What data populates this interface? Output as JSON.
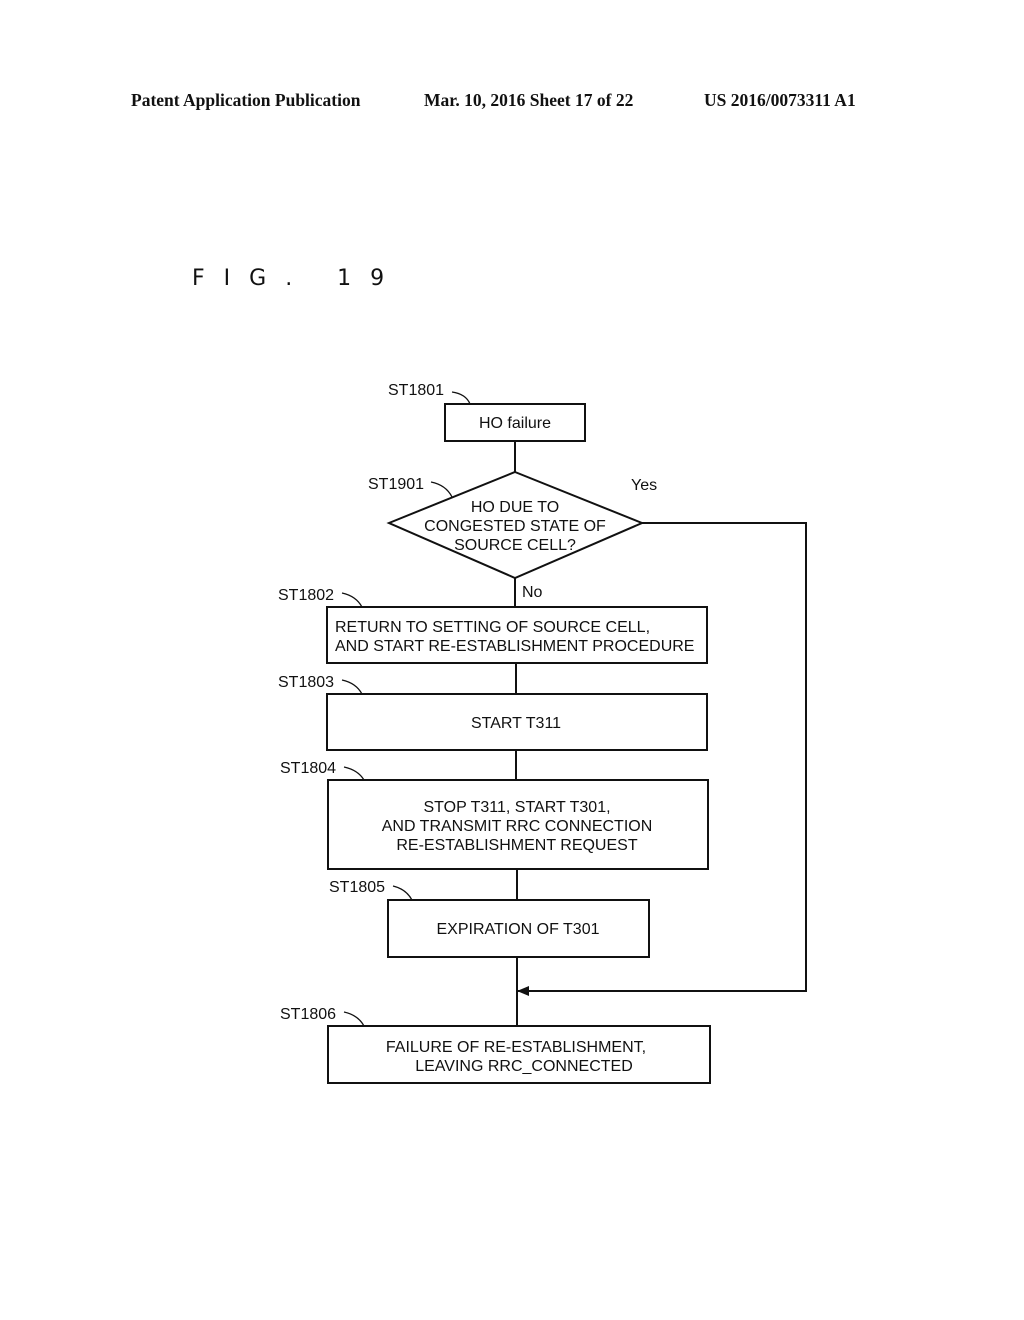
{
  "header": {
    "publication": "Patent Application Publication",
    "date_sheet": "Mar. 10, 2016  Sheet 17 of 22",
    "patent_number": "US 2016/0073311 A1"
  },
  "figure": {
    "title": "FIG. 19"
  },
  "flowchart": {
    "steps": [
      {
        "id": "ST1801",
        "type": "process",
        "lines": [
          "HO failure"
        ]
      },
      {
        "id": "ST1901",
        "type": "decision",
        "lines": [
          "HO DUE TO",
          "CONGESTED STATE OF",
          "SOURCE CELL?"
        ],
        "yes_label": "Yes",
        "no_label": "No"
      },
      {
        "id": "ST1802",
        "type": "process",
        "lines": [
          "RETURN TO SETTING OF SOURCE CELL,",
          "AND START RE-ESTABLISHMENT PROCEDURE"
        ]
      },
      {
        "id": "ST1803",
        "type": "process",
        "lines": [
          "START T311"
        ]
      },
      {
        "id": "ST1804",
        "type": "process",
        "lines": [
          "STOP T311, START T301,",
          "AND TRANSMIT RRC CONNECTION",
          "RE-ESTABLISHMENT REQUEST"
        ]
      },
      {
        "id": "ST1805",
        "type": "process",
        "lines": [
          "EXPIRATION OF T301"
        ]
      },
      {
        "id": "ST1806",
        "type": "process",
        "lines": [
          "FAILURE OF RE-ESTABLISHMENT,",
          "LEAVING RRC_CONNECTED"
        ]
      }
    ],
    "edges": [
      {
        "from": "ST1801",
        "to": "ST1901"
      },
      {
        "from": "ST1901",
        "to": "ST1802",
        "label": "No"
      },
      {
        "from": "ST1901",
        "to": "ST1806",
        "label": "Yes"
      },
      {
        "from": "ST1802",
        "to": "ST1803"
      },
      {
        "from": "ST1803",
        "to": "ST1804"
      },
      {
        "from": "ST1804",
        "to": "ST1805"
      },
      {
        "from": "ST1805",
        "to": "ST1806"
      }
    ]
  }
}
